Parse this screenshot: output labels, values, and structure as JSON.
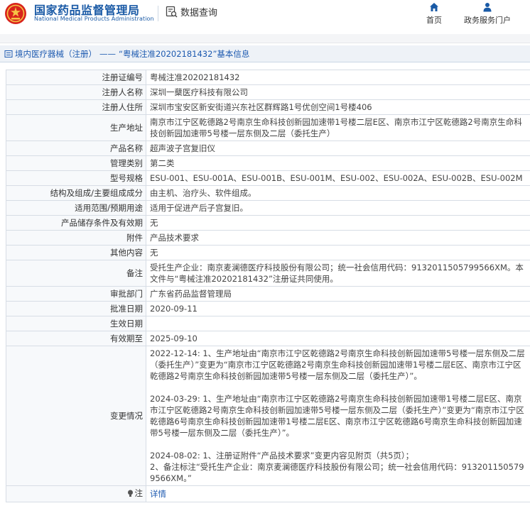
{
  "header": {
    "org_name": "国家药品监督管理局",
    "org_en": "National Medical Products Administration",
    "query_label": "数据查询",
    "nav_home": "首页",
    "nav_portal": "政务服务门户",
    "brand_color": "#1a5aa6"
  },
  "breadcrumb": {
    "section": "境内医疗器械（注册）",
    "separator": "——",
    "title": "“粤械注准20202181432”基本信息"
  },
  "record": {
    "reg_no_label": "注册证编号",
    "reg_no": "粤械注准20202181432",
    "registrant_label": "注册人名称",
    "registrant": "深圳一蘖医疗科技有限公司",
    "address_label": "注册人住所",
    "address": "深圳市宝安区新安街道兴东社区群辉路1号优创空间1号楼406",
    "production_label": "生产地址",
    "production": "南京市江宁区乾德路2号南京生命科技创新园加速带1号楼二层E区、南京市江宁区乾德路2号南京生命科技创新园加速带5号楼一层东侧及二层（委托生产）",
    "product_label": "产品名称",
    "product": "超声波子宫复旧仪",
    "category_label": "管理类别",
    "category": "第二类",
    "model_label": "型号规格",
    "model": "ESU-001、ESU-001A、ESU-001B、ESU-001M、ESU-002、ESU-002A、ESU-002B、ESU-002M",
    "structure_label": "结构及组成/主要组成成分",
    "structure": "由主机、治疗头、软件组成。",
    "scope_label": "适用范围/预期用途",
    "scope": "适用于促进产后子宫复旧。",
    "storage_label": "产品储存条件及有效期",
    "storage": "无",
    "attachment_label": "附件",
    "attachment": "产品技术要求",
    "other_label": "其他内容",
    "other": "无",
    "remark_label": "备注",
    "remark": "受托生产企业：南京麦澜德医疗科技股份有限公司；统一社会信用代码：913201150579956​6XM。本文件与“粤械注准20202181432”注册证共同使用。",
    "dept_label": "审批部门",
    "dept": "广东省药品监督管理局",
    "approve_label": "批准日期",
    "approve": "2020-09-11",
    "effective_label": "生效日期",
    "effective": "",
    "expire_label": "有效期至",
    "expire": "2025-09-10",
    "change_label": "变更情况",
    "change_1": "2022-12-14: 1、生产地址由“南京市江宁区乾德路2号南京生命科技创新园加速带5号楼一层东侧及二层（委托生产）”变更为“南京市江宁区乾德路2号南京生命科技创新园加速带1号楼二层E区、南京市江宁区乾德路2号南京生命科技创新园加速带5号楼一层东侧及二层（委托生产）”。",
    "change_2": "2024-03-29: 1、生产地址由“南京市江宁区乾德路2号南京生命科技创新园加速带1号楼二层E区、南京市江宁区乾德路2号南京生命科技创新园加速带5号楼一层东侧及二层（委托生产）”变更为“南京市江宁区乾德路6号南京生命科技创新园加速带1号楼二层E区、南京市江宁区乾德路6号南京生命科技创新园加速带5号楼一层东侧及二层（委托生产）”。",
    "change_3a": "2024-08-02: 1、注册证附件“产品技术要求”变更内容见附页（共5页）；",
    "change_3b": "2、备注标注“受托生产企业：南京麦澜德医疗科技股份有限公司；统一社会信用代码：913201150579956​6XM。”",
    "note_label": "注",
    "note_link": "详情"
  }
}
